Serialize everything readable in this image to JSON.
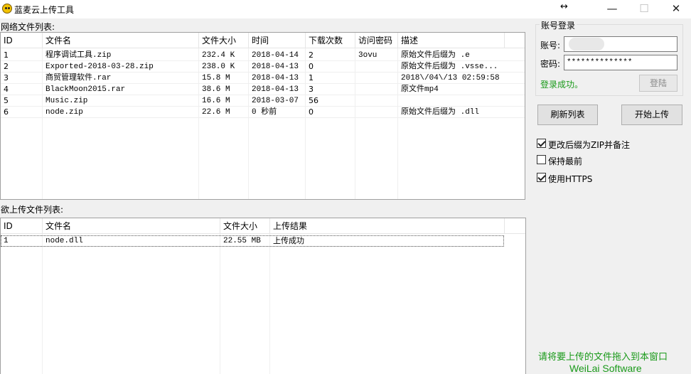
{
  "window": {
    "title": "蓝麦云上传工具",
    "resize_glyph": "↔",
    "minimize": "—",
    "maximize": "☐",
    "close": "✕"
  },
  "remote": {
    "label": "网络文件列表:",
    "columns": [
      "ID",
      "文件名",
      "文件大小",
      "时间",
      "下载次数",
      "访问密码",
      "描述"
    ],
    "rows": [
      [
        "1",
        "程序调试工具.zip",
        "232.4 K",
        "2018-04-14",
        "2",
        "3ovu",
        "原始文件后缀为 .e"
      ],
      [
        "2",
        "Exported-2018-03-28.zip",
        "238.0 K",
        "2018-04-13",
        "0",
        "",
        "原始文件后缀为 .vsse..."
      ],
      [
        "3",
        "商贸管理软件.rar",
        "15.8 M",
        "2018-04-13",
        "1",
        "",
        "2018\\/04\\/13 02:59:58"
      ],
      [
        "4",
        "BlackMoon2015.rar",
        "38.6 M",
        "2018-04-13",
        "3",
        "",
        "原文件mp4"
      ],
      [
        "5",
        "Music.zip",
        "16.6 M",
        "2018-03-07",
        "56",
        "",
        ""
      ],
      [
        "6",
        "node.zip",
        "22.6 M",
        "0 秒前",
        "0",
        "",
        "原始文件后缀为 .dll"
      ]
    ]
  },
  "upload": {
    "label": "欲上传文件列表:",
    "columns": [
      "ID",
      "文件名",
      "文件大小",
      "上传结果"
    ],
    "rows": [
      [
        "1",
        "node.dll",
        "22.55 MB",
        "上传成功"
      ]
    ]
  },
  "login": {
    "group_title": "账号登录",
    "account_label": "账号:",
    "account_value": "",
    "password_label": "密码:",
    "password_value": "**************",
    "status": "登录成功。",
    "login_button": "登陆"
  },
  "actions": {
    "refresh": "刷新列表",
    "start_upload": "开始上传"
  },
  "options": [
    {
      "label": "更改后缀为ZIP并备注",
      "checked": true
    },
    {
      "label": "保持最前",
      "checked": false
    },
    {
      "label": "使用HTTPS",
      "checked": true
    }
  ],
  "footer": {
    "hint": "请将要上传的文件拖入到本窗口",
    "brand": "WeiLai Software"
  },
  "colors": {
    "accent_green": "#1a9a1a"
  }
}
